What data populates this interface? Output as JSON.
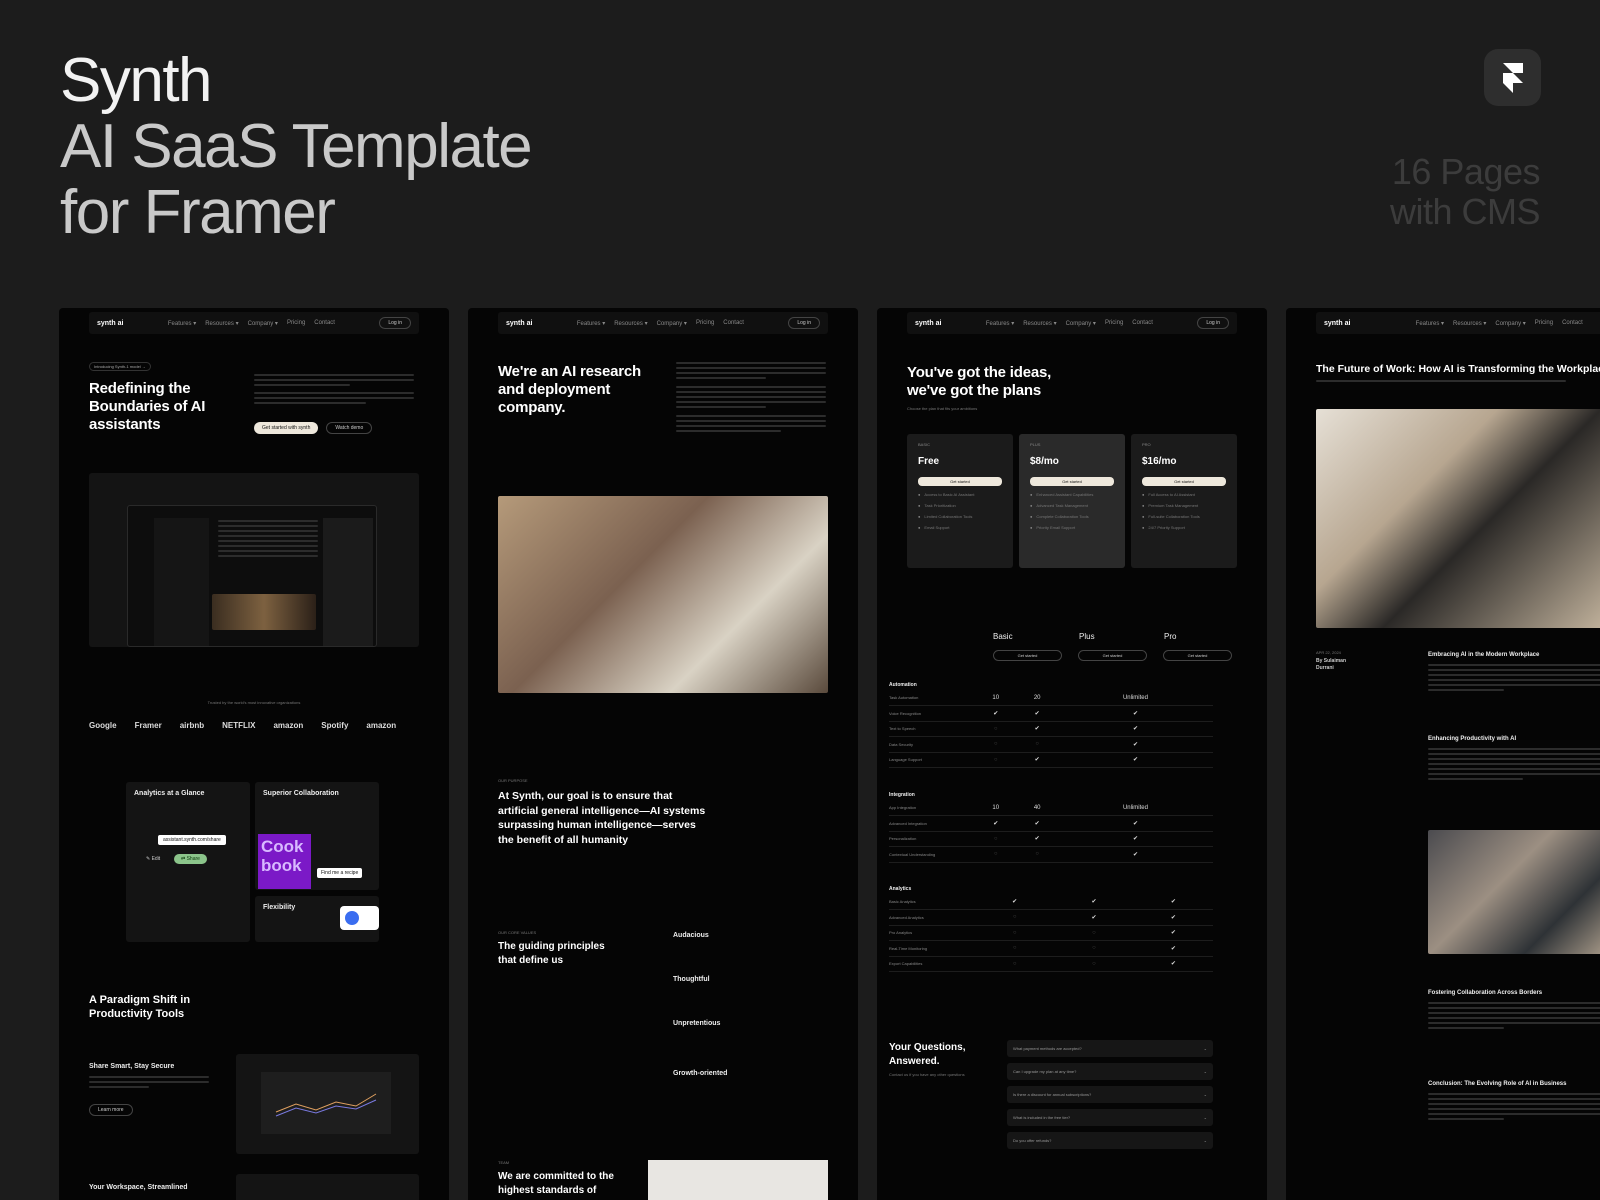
{
  "hero": {
    "line1": "Synth",
    "line2": "AI SaaS Template",
    "line3": "for Framer",
    "pages_line1": "16 Pages",
    "pages_line2": "with CMS"
  },
  "nav": {
    "brand": "synth ai",
    "links": [
      "Features ▾",
      "Resources ▾",
      "Company ▾",
      "Pricing",
      "Contact"
    ],
    "login": "Log in"
  },
  "home": {
    "badge": "Introducing Synth-1 model →",
    "title": "Redefining the Boundaries of AI assistants",
    "cta_primary": "Get started with synth",
    "cta_secondary": "Watch demo",
    "trusted": "Trusted by the world's most innovative organizations",
    "logos": [
      "Google",
      "Framer",
      "airbnb",
      "NETFLIX",
      "amazon",
      "Spotify",
      "amazon"
    ],
    "feature1": "Analytics at a Glance",
    "feature2": "Superior Collaboration",
    "feature3": "Flexibility",
    "share_url": "assistant.synth.com/share",
    "edit": "✎ Edit",
    "share": "⇄ Share",
    "cook": "Cook book",
    "find_recipe": "Find me a recipe",
    "paradigm": "A Paradigm Shift in Productivity Tools",
    "share_smart": "Share Smart, Stay Secure",
    "learn_more": "Learn more",
    "workspace": "Your Workspace, Streamlined"
  },
  "about": {
    "title": "We're an AI research and deployment company.",
    "purpose_label": "OUR PURPOSE",
    "purpose": "At Synth, our goal is to ensure that artificial general intelligence—AI systems surpassing human intelligence—serves the benefit of all humanity",
    "values_label": "OUR CORE VALUES",
    "values_title": "The guiding principles that define us",
    "values": [
      "Audacious",
      "Thoughtful",
      "Unpretentious",
      "Growth-oriented"
    ],
    "team_label": "TEAM",
    "committed": "We are committed to the highest standards of"
  },
  "pricing": {
    "title": "You've got the ideas, we've got the plans",
    "subtitle": "Choose the plan that fits your ambitions",
    "plans": [
      {
        "name": "BASIC",
        "price": "Free",
        "btn": "Get started",
        "features": [
          "Access to Basic AI Assistant",
          "Task Prioritization",
          "Limited Collaboration Tools",
          "Email Support"
        ]
      },
      {
        "name": "PLUS",
        "price": "$8/mo",
        "btn": "Get started",
        "features": [
          "Enhanced Assistant Capabilities",
          "Advanced Task Management",
          "Complete Collaboration Tools",
          "Priority Email Support"
        ]
      },
      {
        "name": "PRO",
        "price": "$16/mo",
        "btn": "Get started",
        "features": [
          "Full Access to AI Assistant",
          "Premium Task Management",
          "Full-suite Collaboration Tools",
          "24/7 Priority Support"
        ]
      }
    ],
    "columns": [
      "Basic",
      "Plus",
      "Pro"
    ],
    "col_btn": "Get started",
    "sections": [
      {
        "title": "Automation",
        "rows": [
          [
            "Task Automation",
            "10",
            "20",
            "Unlimited"
          ],
          [
            "Voice Recognition",
            "✔",
            "✔",
            "✔"
          ],
          [
            "Text to Speech",
            "○",
            "✔",
            "✔"
          ],
          [
            "Data Security",
            "○",
            "○",
            "✔"
          ],
          [
            "Language Support",
            "○",
            "✔",
            "✔"
          ]
        ]
      },
      {
        "title": "Integration",
        "rows": [
          [
            "App Integration",
            "10",
            "40",
            "Unlimited"
          ],
          [
            "Advanced Integration",
            "✔",
            "✔",
            "✔"
          ],
          [
            "Personalization",
            "○",
            "✔",
            "✔"
          ],
          [
            "Contextual Understanding",
            "○",
            "○",
            "✔"
          ]
        ]
      },
      {
        "title": "Analytics",
        "rows": [
          [
            "Basic Analytics",
            "✔",
            "✔",
            "✔"
          ],
          [
            "Advanced Analytics",
            "○",
            "✔",
            "✔"
          ],
          [
            "Pro Analytics",
            "○",
            "○",
            "✔"
          ],
          [
            "Real-Time Monitoring",
            "○",
            "○",
            "✔"
          ],
          [
            "Export Capabilities",
            "○",
            "○",
            "✔"
          ]
        ]
      }
    ],
    "faq_title": "Your Questions, Answered.",
    "faq_sub": "Contact us if you have any other questions",
    "faqs": [
      "What payment methods are accepted?",
      "Can I upgrade my plan at any time?",
      "Is there a discount for annual subscriptions?",
      "What is included in the free tier?",
      "Do you offer refunds?"
    ]
  },
  "blog": {
    "title": "The Future of Work: How AI is Transforming the Workplace",
    "date": "APR 22, 2024",
    "author": "By Sulaiman Durrani",
    "h1": "Embracing AI in the Modern Workplace",
    "h2": "Enhancing Productivity with AI",
    "h3": "Fostering Collaboration Across Borders",
    "h4": "Conclusion: The Evolving Role of AI in Business"
  }
}
